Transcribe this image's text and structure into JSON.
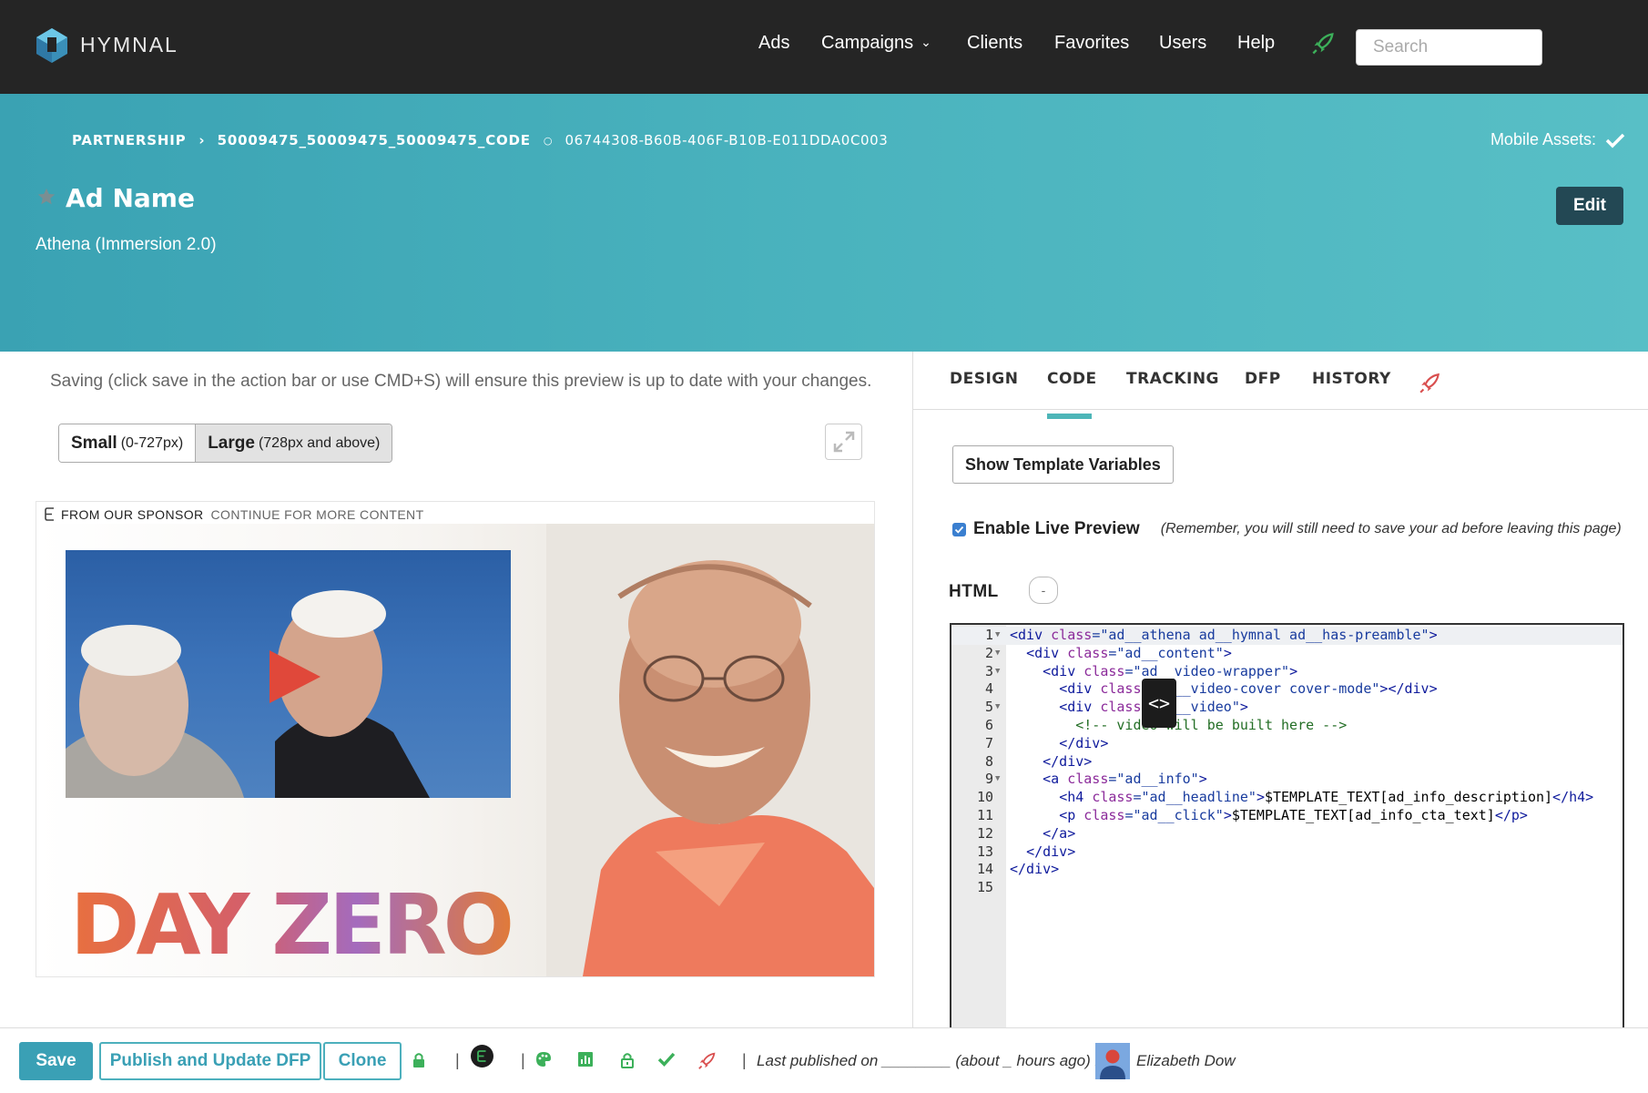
{
  "app": {
    "name": "HYMNAL"
  },
  "nav": {
    "links": [
      "Ads",
      "Campaigns",
      "Clients",
      "Favorites",
      "Users",
      "Help"
    ],
    "search_placeholder": "Search"
  },
  "hero": {
    "breadcrumb": [
      "PARTNERSHIP",
      "50009475_50009475_50009475_CODE",
      "06744308-B60B-406F-B10B-E011DDA0C003"
    ],
    "mobile_assets_label": "Mobile Assets:",
    "title": "Ad Name",
    "subtitle": "Athena (Immersion 2.0)",
    "edit_label": "Edit"
  },
  "preview": {
    "note": "Saving (click save in the action bar or use CMD+S) will ensure this preview is up to date with your changes.",
    "sizes": [
      {
        "name": "Small",
        "range": "(0-727px)",
        "selected": false
      },
      {
        "name": "Large",
        "range": "(728px and above)",
        "selected": true
      }
    ],
    "sponsor_from": "FROM OUR SPONSOR",
    "sponsor_continue": "CONTINUE FOR MORE CONTENT",
    "ad_headline": "DAY ZERO"
  },
  "editor_panel": {
    "tabs": [
      "DESIGN",
      "CODE",
      "TRACKING",
      "DFP",
      "HISTORY"
    ],
    "active_tab": "CODE",
    "show_vars_label": "Show Template Variables",
    "live_preview_label": "Enable Live Preview",
    "live_preview_checked": true,
    "live_preview_note": "(Remember, you will still need to save your ad before leaving this page)",
    "html_label": "HTML",
    "collapse_label": "-",
    "code_lines": [
      "<div class=\"ad__athena ad__hymnal ad__has-preamble\">",
      "  <div class=\"ad__content\">",
      "    <div class=\"ad__video-wrapper\">",
      "      <div class=\"ad__video-cover cover-mode\"></div>",
      "      <div class=\"ad__video\">",
      "        <!-- video will be built here -->",
      "      </div>",
      "    </div>",
      "    <a class=\"ad__info\">",
      "      <h4 class=\"ad__headline\">$TEMPLATE_TEXT[ad_info_description]</h4>",
      "      <p class=\"ad__click\">$TEMPLATE_TEXT[ad_info_cta_text]</p>",
      "    </a>",
      "  </div>",
      "</div>",
      ""
    ]
  },
  "action_bar": {
    "save_label": "Save",
    "publish_label": "Publish and Update DFP",
    "clone_label": "Clone",
    "published_text": "Last published on ________ (about _ hours ago) by",
    "published_by": "Elizabeth Dow"
  },
  "colors": {
    "navbar": "#252525",
    "hero_teal": "#4ab3be",
    "accent_teal": "#3aa0b5",
    "edit_button": "#234854",
    "rocket_green": "#3cb05a",
    "rocket_red": "#d94f4f"
  },
  "icons": [
    "hymnal-logo-icon",
    "chevron-down-icon",
    "rocket-icon",
    "checkmark-icon",
    "star-icon",
    "expand-icon",
    "play-icon",
    "sponsor-e-icon",
    "lock-icon",
    "palette-icon",
    "chart-icon",
    "code-icon",
    "user-avatar"
  ]
}
